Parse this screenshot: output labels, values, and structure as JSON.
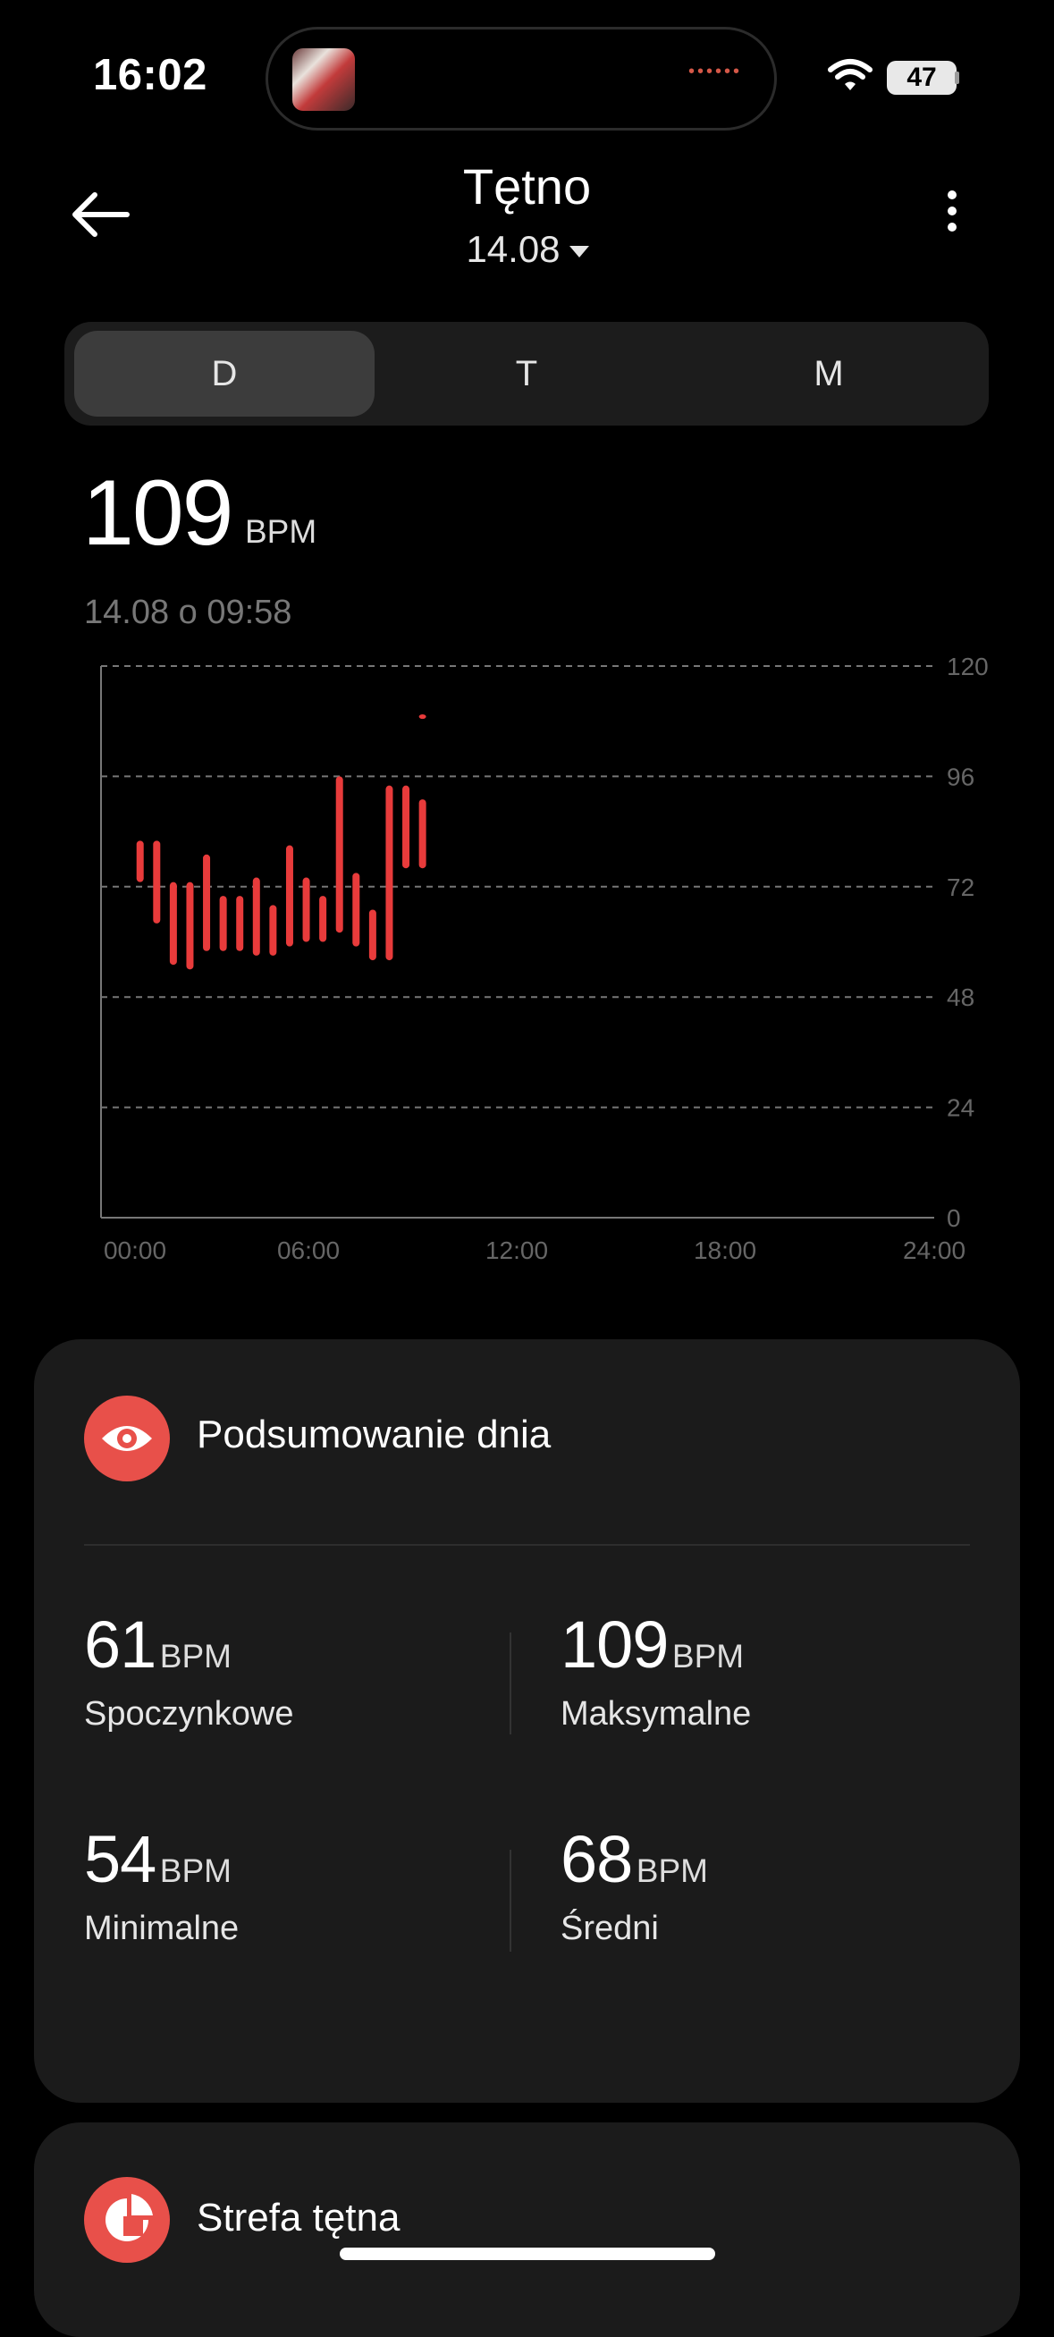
{
  "status_bar": {
    "time": "16:02",
    "battery": "47"
  },
  "header": {
    "title": "Tętno",
    "date": "14.08"
  },
  "tabs": [
    {
      "label": "D",
      "active": true
    },
    {
      "label": "T",
      "active": false
    },
    {
      "label": "M",
      "active": false
    }
  ],
  "reading": {
    "value": "109",
    "unit": "BPM",
    "timestamp": "14.08 o 09:58"
  },
  "chart_data": {
    "type": "bar",
    "x_ticks": [
      "00:00",
      "06:00",
      "12:00",
      "18:00",
      "24:00"
    ],
    "y_ticks": [
      "120",
      "96",
      "72",
      "48",
      "24",
      "0"
    ],
    "xlim_hours": [
      0,
      24
    ],
    "ylim": [
      0,
      120
    ],
    "grid": "dashed-horizontal",
    "color": "#e83b3b",
    "bars": [
      {
        "hour": 0.1,
        "low": 73,
        "high": 82
      },
      {
        "hour": 0.6,
        "low": 64,
        "high": 82
      },
      {
        "hour": 1.1,
        "low": 55,
        "high": 73
      },
      {
        "hour": 1.6,
        "low": 54,
        "high": 73
      },
      {
        "hour": 2.1,
        "low": 58,
        "high": 79
      },
      {
        "hour": 2.6,
        "low": 58,
        "high": 70
      },
      {
        "hour": 3.1,
        "low": 58,
        "high": 70
      },
      {
        "hour": 3.6,
        "low": 57,
        "high": 74
      },
      {
        "hour": 4.1,
        "low": 57,
        "high": 68
      },
      {
        "hour": 4.6,
        "low": 59,
        "high": 81
      },
      {
        "hour": 5.1,
        "low": 60,
        "high": 74
      },
      {
        "hour": 5.6,
        "low": 60,
        "high": 70
      },
      {
        "hour": 6.1,
        "low": 62,
        "high": 96
      },
      {
        "hour": 6.6,
        "low": 59,
        "high": 75
      },
      {
        "hour": 7.1,
        "low": 56,
        "high": 67
      },
      {
        "hour": 7.6,
        "low": 56,
        "high": 94
      },
      {
        "hour": 8.1,
        "low": 76,
        "high": 94
      },
      {
        "hour": 8.6,
        "low": 76,
        "high": 91
      },
      {
        "hour": 8.6,
        "low": 108.5,
        "high": 109.5
      }
    ]
  },
  "summary": {
    "title": "Podsumowanie dnia",
    "resting": {
      "value": "61",
      "unit": "BPM",
      "label": "Spoczynkowe"
    },
    "max": {
      "value": "109",
      "unit": "BPM",
      "label": "Maksymalne"
    },
    "min": {
      "value": "54",
      "unit": "BPM",
      "label": "Minimalne"
    },
    "avg": {
      "value": "68",
      "unit": "BPM",
      "label": "Średni"
    }
  },
  "zone_card": {
    "title": "Strefa tętna"
  },
  "icons": {
    "back": "arrow-left-icon",
    "more": "more-vertical-icon",
    "summary": "eye-icon",
    "zone": "pie-chart-icon",
    "wifi": "wifi-icon"
  }
}
